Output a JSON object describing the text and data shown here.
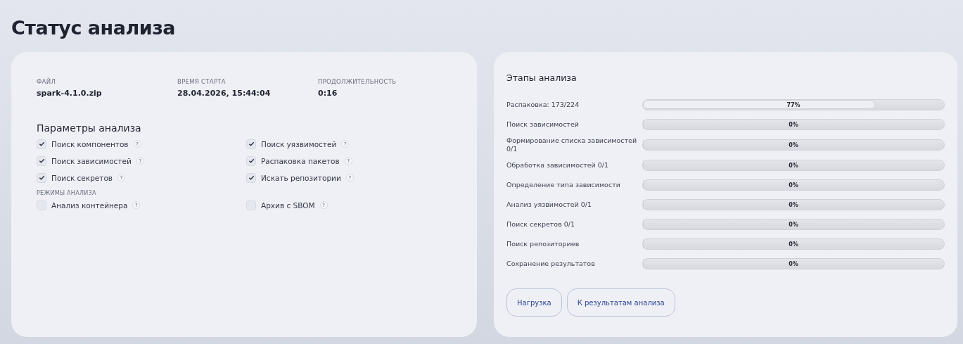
{
  "page_title": "Статус анализа",
  "info": {
    "fields": [
      {
        "label": "ФАЙЛ",
        "value": "spark-4.1.0.zip"
      },
      {
        "label": "ВРЕМЯ СТАРТА",
        "value": "28.04.2026, 15:44:04"
      },
      {
        "label": "ПРОДОЛЖИТЕЛЬНОСТЬ",
        "value": "0:16"
      }
    ],
    "params_title": "Параметры анализа",
    "params": [
      {
        "label": "Поиск компонентов",
        "checked": true
      },
      {
        "label": "Поиск уязвимостей",
        "checked": true
      },
      {
        "label": "Поиск зависимостей",
        "checked": true
      },
      {
        "label": "Распаковка пакетов",
        "checked": true
      },
      {
        "label": "Поиск секретов",
        "checked": true
      },
      {
        "label": "Искать репозитории",
        "checked": true
      }
    ],
    "modes_title": "РЕЖИМЫ АНАЛИЗА",
    "modes": [
      {
        "label": "Анализ контейнера",
        "checked": false
      },
      {
        "label": "Архив с SBOM",
        "checked": false
      }
    ],
    "help_mark": "?"
  },
  "stages": {
    "title": "Этапы анализа",
    "items": [
      {
        "label": "Распаковка: 173/224",
        "level": 0.77,
        "reading": "77%"
      },
      {
        "label": "Поиск зависимостей",
        "level": 0,
        "reading": "0%"
      },
      {
        "label": "Формирование списка зависимостей 0/1",
        "level": 0,
        "reading": "0%"
      },
      {
        "label": "Обработка зависимостей 0/1",
        "level": 0,
        "reading": "0%"
      },
      {
        "label": "Определение типа зависимости",
        "level": 0,
        "reading": "0%"
      },
      {
        "label": "Анализ уязвимостей 0/1",
        "level": 0,
        "reading": "0%"
      },
      {
        "label": "Поиск секретов 0/1",
        "level": 0,
        "reading": "0%"
      },
      {
        "label": "Поиск репозиториев",
        "level": 0,
        "reading": "0%"
      },
      {
        "label": "Сохранение результатов",
        "level": 0,
        "reading": "0%"
      }
    ],
    "buttons": [
      "Нагрузка",
      "К результатам анализа"
    ]
  }
}
